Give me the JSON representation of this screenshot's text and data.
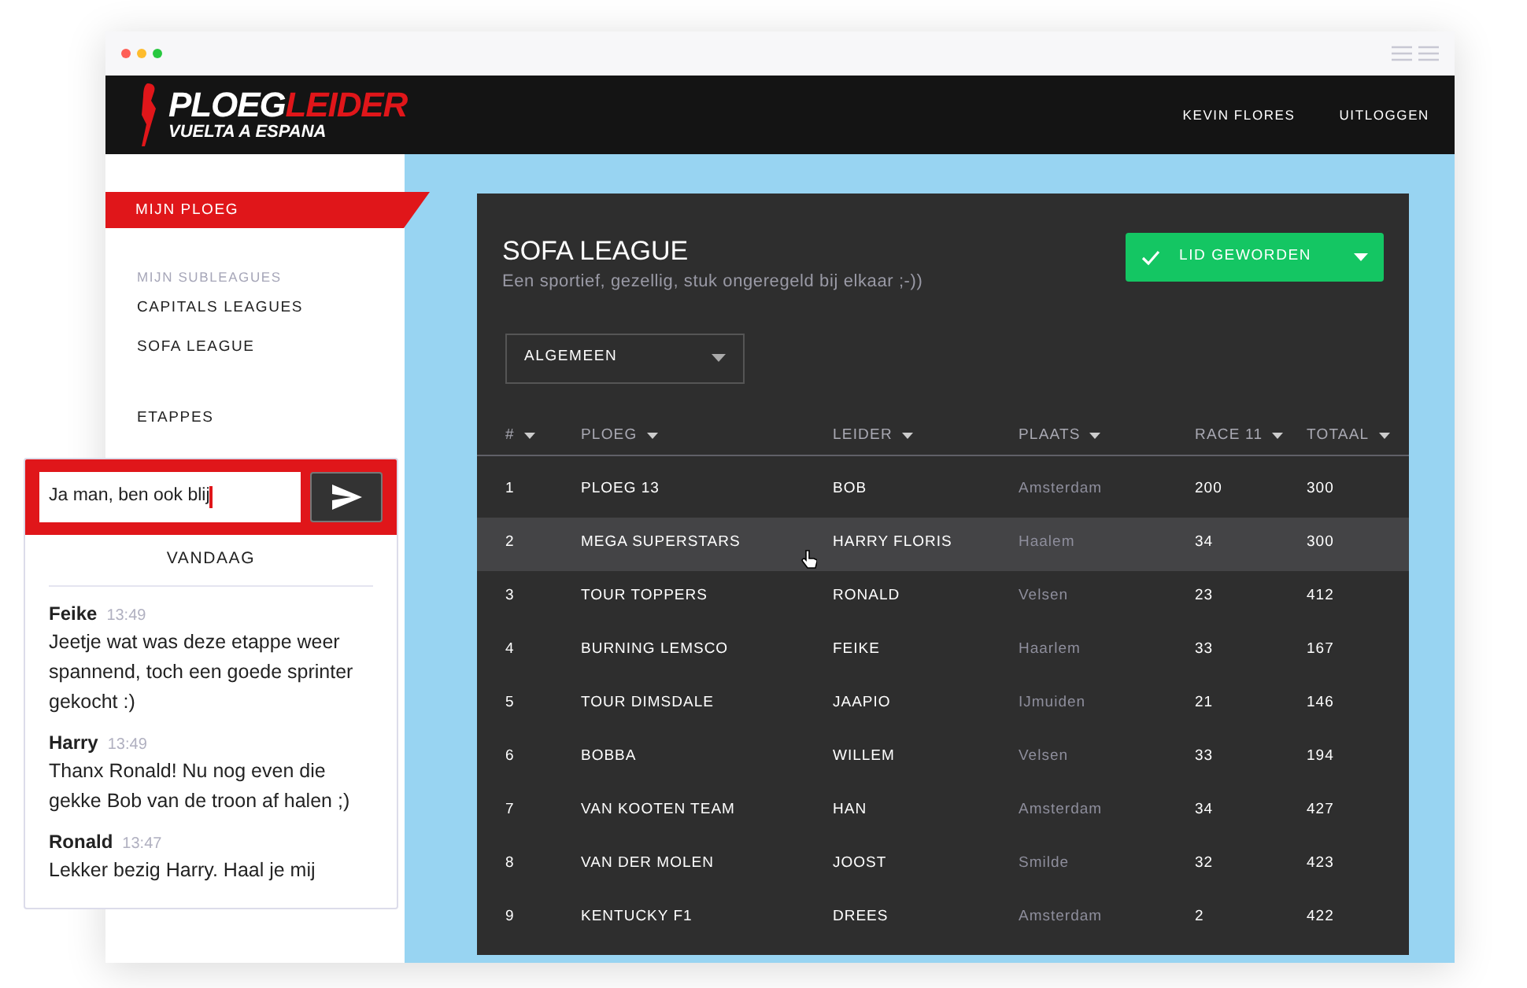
{
  "header": {
    "logo": {
      "first": "PLOEG",
      "second": "LEIDER",
      "subtitle": "VUELTA A ESPANA"
    },
    "links": [
      "KEVIN FLORES",
      "UITLOGGEN"
    ]
  },
  "sidebar": {
    "items": [
      {
        "kind": "link",
        "label": "MIJN PLOEG",
        "selected": true
      },
      {
        "kind": "heading",
        "label": "MIJN SUBLEAGUES"
      },
      {
        "kind": "link",
        "label": "CAPITALS LEAGUES",
        "selected": false
      },
      {
        "kind": "link",
        "label": "SOFA LEAGUE",
        "selected": false
      },
      {
        "kind": "spacer"
      },
      {
        "kind": "link",
        "label": "ETAPPES",
        "selected": false
      }
    ]
  },
  "league": {
    "title": "SOFA LEAGUE",
    "subtitle": "Een sportief, gezellig, stuk ongeregeld bij elkaar ;-))",
    "join_button": "LID GEWORDEN",
    "filter": "ALGEMEEN"
  },
  "table": {
    "columns": [
      "#",
      "PLOEG",
      "LEIDER",
      "PLAATS",
      "RACE 11",
      "TOTAAL"
    ],
    "rows": [
      {
        "cells": [
          "1",
          "PLOEG 13",
          "BOB",
          "Amsterdam",
          "200",
          "300"
        ],
        "hovered": false
      },
      {
        "cells": [
          "2",
          "MEGA SUPERSTARS",
          "HARRY FLORIS",
          "Haalem",
          "34",
          "300"
        ],
        "hovered": true
      },
      {
        "cells": [
          "3",
          "TOUR TOPPERS",
          "RONALD",
          "Velsen",
          "23",
          "412"
        ],
        "hovered": false
      },
      {
        "cells": [
          "4",
          "BURNING LEMSCO",
          "FEIKE",
          "Haarlem",
          "33",
          "167"
        ],
        "hovered": false
      },
      {
        "cells": [
          "5",
          "TOUR DIMSDALE",
          "JAAPIO",
          "IJmuiden",
          "21",
          "146"
        ],
        "hovered": false
      },
      {
        "cells": [
          "6",
          "BOBBA",
          "WILLEM",
          "Velsen",
          "33",
          "194"
        ],
        "hovered": false
      },
      {
        "cells": [
          "7",
          "VAN KOOTEN TEAM",
          "HAN",
          "Amsterdam",
          "34",
          "427"
        ],
        "hovered": false
      },
      {
        "cells": [
          "8",
          "VAN DER MOLEN",
          "JOOST",
          "Smilde",
          "32",
          "423"
        ],
        "hovered": false
      },
      {
        "cells": [
          "9",
          "KENTUCKY F1",
          "DREES",
          "Amsterdam",
          "2",
          "422"
        ],
        "hovered": false
      }
    ]
  },
  "chat": {
    "input_value": "Ja man, ben ook blij",
    "day": "VANDAAG",
    "messages": [
      {
        "author": "Feike",
        "time": "13:49",
        "text": "Jeetje wat was deze etappe weer spannend, toch een goede sprinter gekocht :)"
      },
      {
        "author": "Harry",
        "time": "13:49",
        "text": "Thanx Ronald! Nu nog even die gekke Bob van de troon af halen ;)"
      },
      {
        "author": "Ronald",
        "time": "13:47",
        "text": "Lekker bezig Harry. Haal je mij"
      }
    ]
  }
}
